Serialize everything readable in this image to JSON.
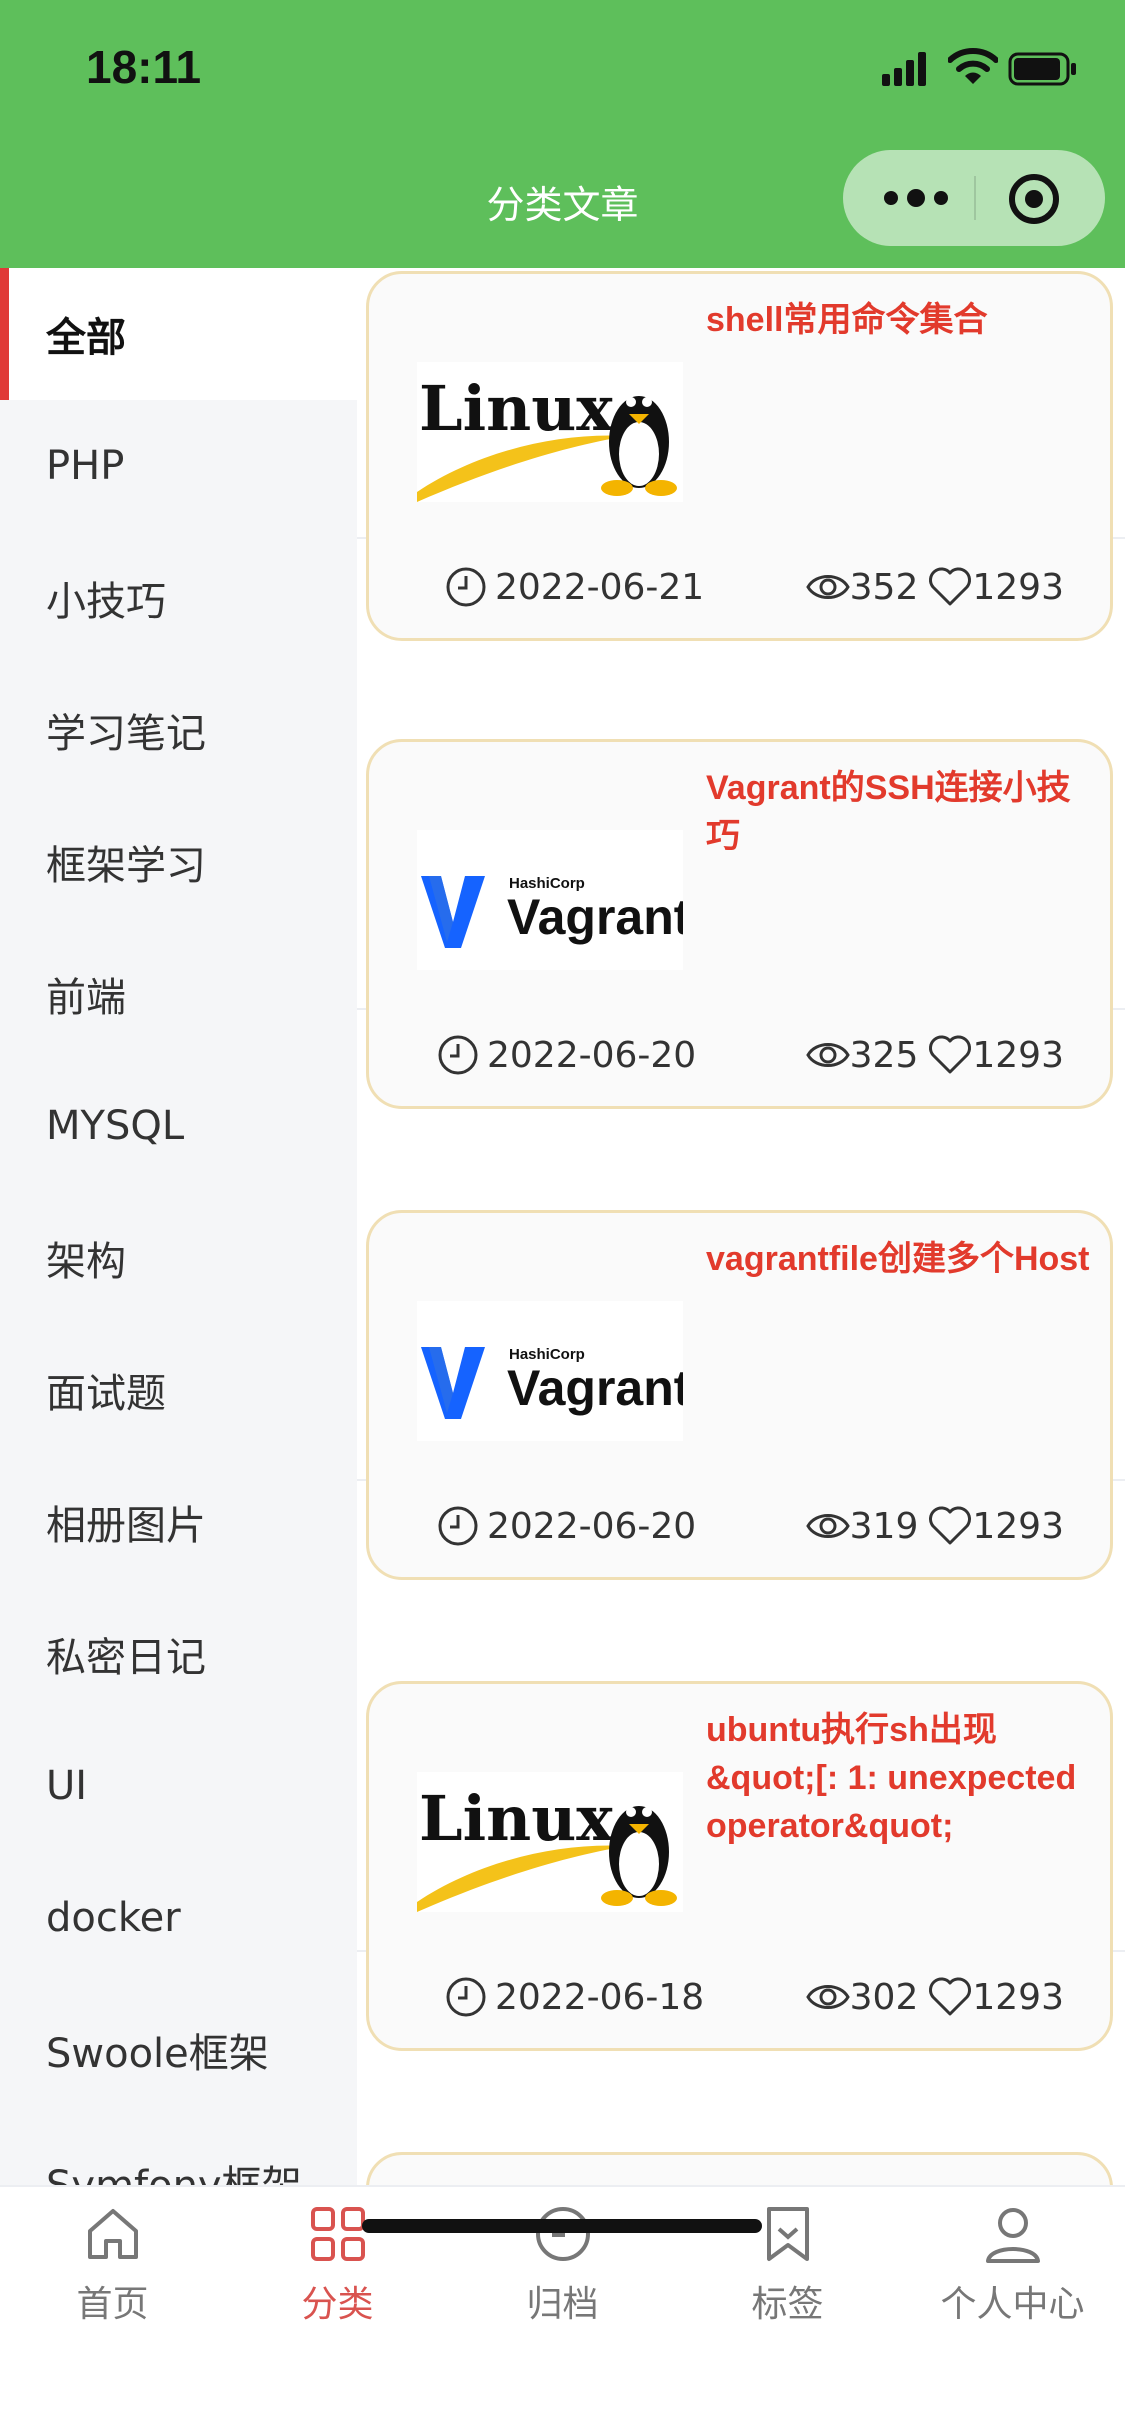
{
  "status_bar": {
    "time": "18:11"
  },
  "nav": {
    "title": "分类文章"
  },
  "sidebar": {
    "items": [
      {
        "label": "全部",
        "active": true
      },
      {
        "label": "PHP"
      },
      {
        "label": "小技巧"
      },
      {
        "label": "学习笔记"
      },
      {
        "label": "框架学习"
      },
      {
        "label": "前端"
      },
      {
        "label": "MYSQL"
      },
      {
        "label": "架构"
      },
      {
        "label": "面试题"
      },
      {
        "label": "相册图片"
      },
      {
        "label": "私密日记"
      },
      {
        "label": "UI"
      },
      {
        "label": "docker"
      },
      {
        "label": "Swoole框架"
      },
      {
        "label": "Symfony框架"
      }
    ]
  },
  "articles": [
    {
      "title": "shell常用命令集合",
      "thumb": "Linux",
      "date": "2022-06-21",
      "views": "352",
      "likes": "1293"
    },
    {
      "title": "Vagrant的SSH连接小技巧",
      "thumb": "Vagrant",
      "date": "2022-06-20",
      "views": "325",
      "likes": "1293"
    },
    {
      "title": "vagrantfile创建多个Host",
      "thumb": "Vagrant",
      "date": "2022-06-20",
      "views": "319",
      "likes": "1293"
    },
    {
      "title": "ubuntu执行sh出现&quot;[: 1: unexpected operator&quot;",
      "thumb": "Linux",
      "date": "2022-06-18",
      "views": "302",
      "likes": "1293"
    }
  ],
  "tabbar": {
    "tabs": [
      {
        "label": "首页",
        "icon": "home-icon"
      },
      {
        "label": "分类",
        "icon": "category-icon",
        "active": true
      },
      {
        "label": "归档",
        "icon": "clock-icon"
      },
      {
        "label": "标签",
        "icon": "bookmark-icon"
      },
      {
        "label": "个人中心",
        "icon": "person-icon"
      }
    ]
  },
  "colors": {
    "header": "#5ebf5b",
    "accent": "#e03a37",
    "title": "#e23a2c",
    "card_border": "#f0dfb4"
  }
}
